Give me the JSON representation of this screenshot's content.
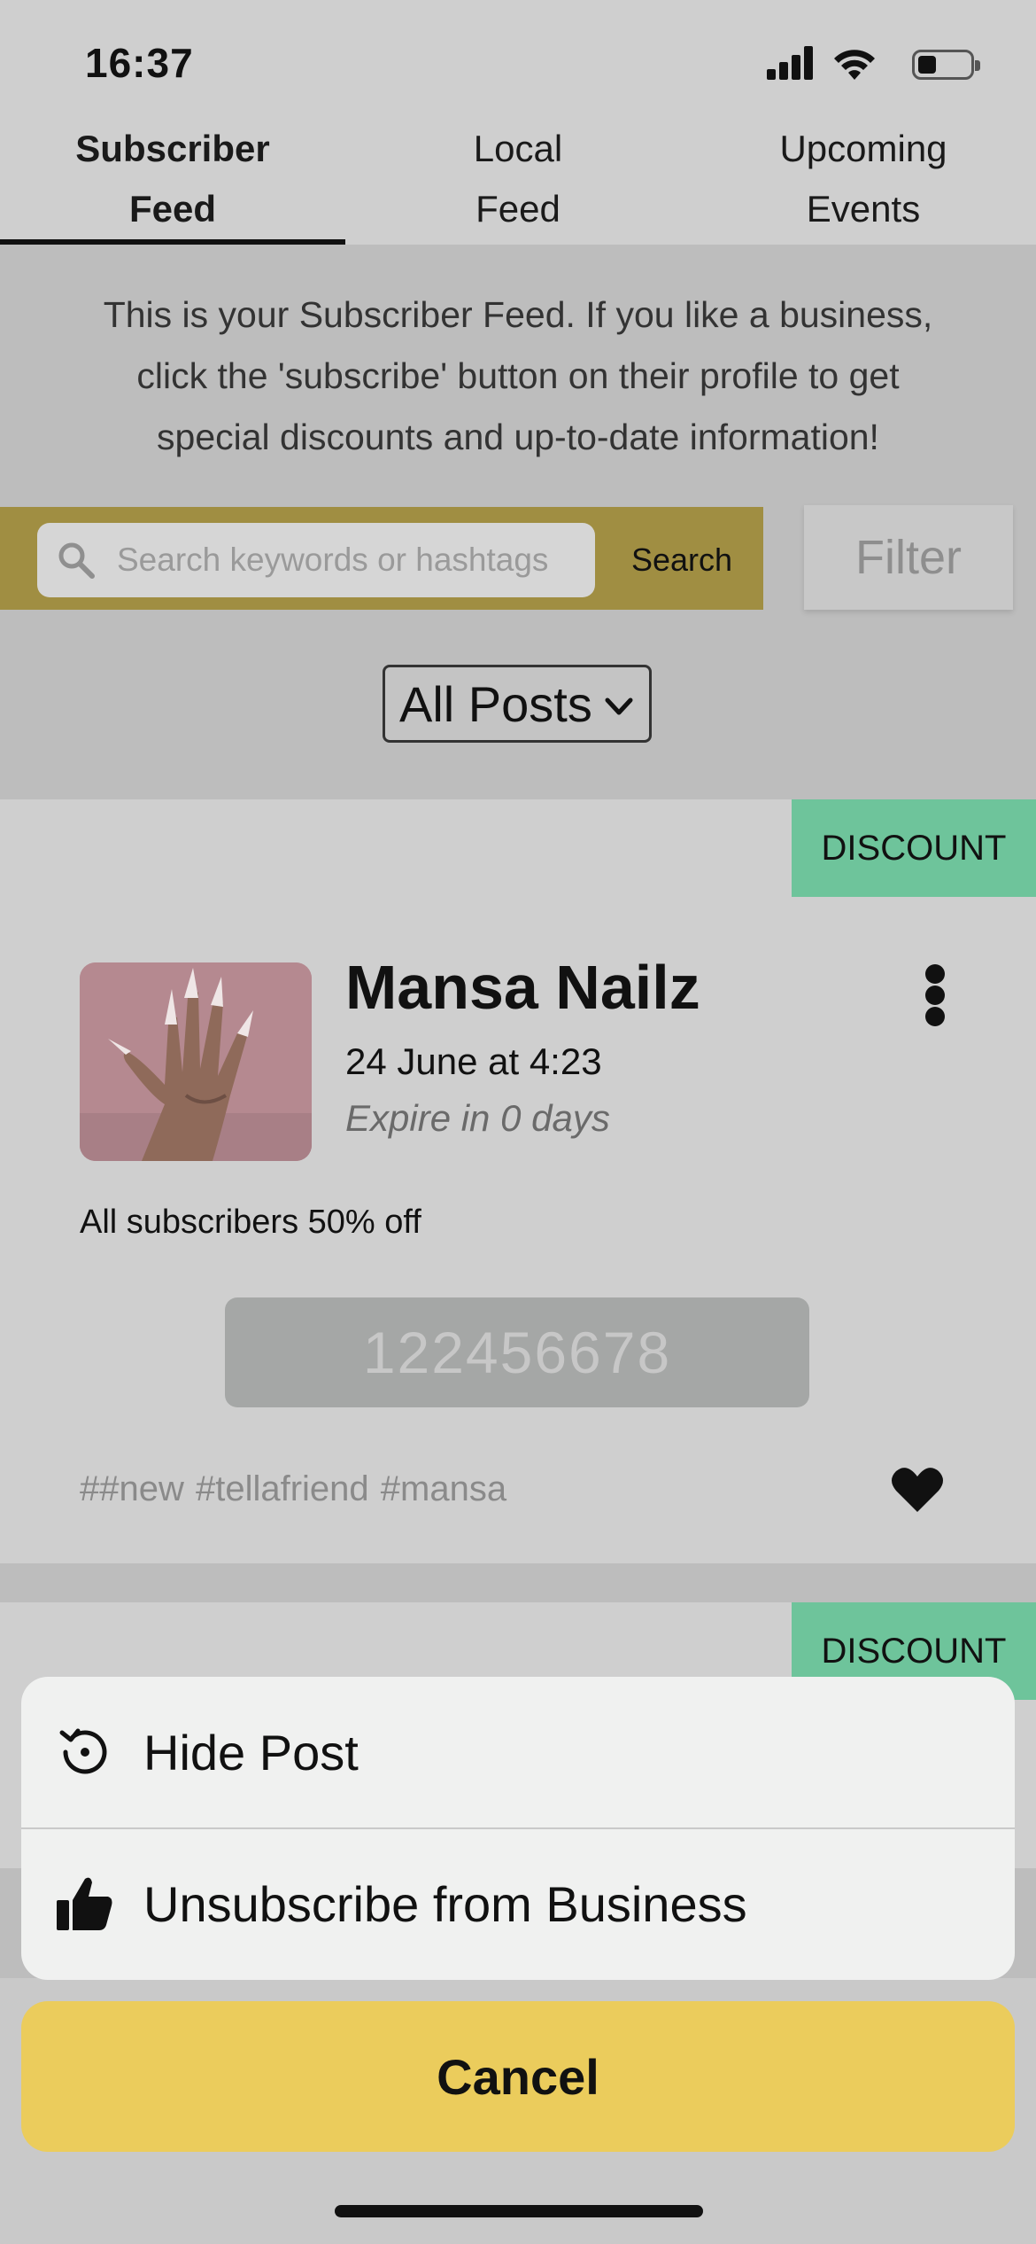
{
  "status_bar": {
    "time": "16:37",
    "battery_fraction": 0.35
  },
  "tabs": [
    {
      "line1": "Subscriber",
      "line2": "Feed",
      "active": true
    },
    {
      "line1": "Local",
      "line2": "Feed",
      "active": false
    },
    {
      "line1": "Upcoming",
      "line2": "Events",
      "active": false
    }
  ],
  "intro": {
    "text": "This is your Subscriber Feed. If you like a business, click the 'subscribe' button on their profile to get special discounts and up-to-date information!"
  },
  "search": {
    "placeholder": "Search keywords or hashtags",
    "button_label": "Search",
    "filter_label": "Filter"
  },
  "posts_filter": {
    "selected": "All Posts"
  },
  "post": {
    "badge": "DISCOUNT",
    "business_name": "Mansa Nailz",
    "date": "24 June at 4:23",
    "expire": "Expire in 0 days",
    "body": "All subscribers 50% off",
    "code": "122456678",
    "hashtags": "##new  #tellafriend #mansa",
    "liked": true
  },
  "post2": {
    "badge": "DISCOUNT"
  },
  "action_sheet": {
    "items": [
      {
        "label": "Hide Post",
        "icon": "history-icon"
      },
      {
        "label": "Unsubscribe from Business",
        "icon": "thumbs-up-icon"
      }
    ],
    "cancel_label": "Cancel"
  },
  "colors": {
    "search_bar": "#a08e42",
    "discount_badge": "#6ec49b",
    "cancel_button": "#ebcc5c"
  }
}
